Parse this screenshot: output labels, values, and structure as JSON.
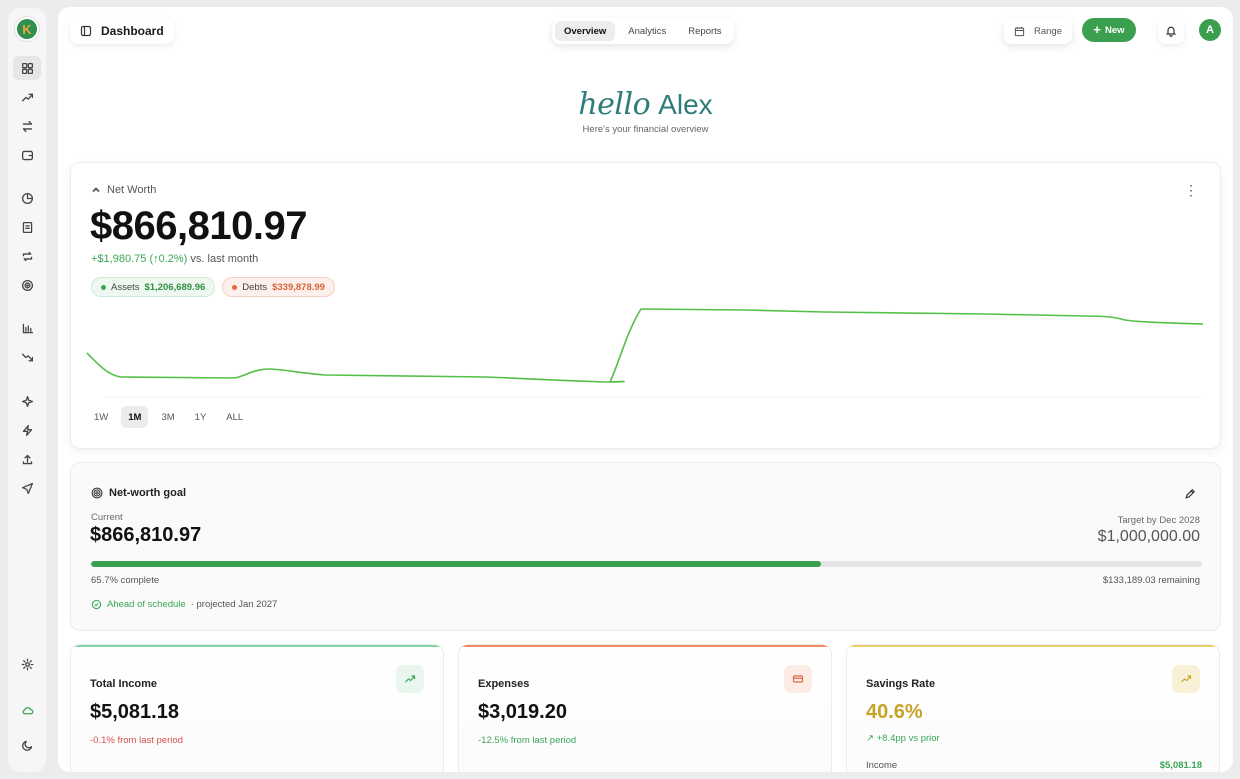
{
  "header": {
    "title": "Dashboard",
    "tabs": [
      "Overview",
      "Analytics",
      "Reports"
    ],
    "range_label": "Range",
    "new_label": "New",
    "avatar_initial": "A"
  },
  "greeting": {
    "hello": "hello",
    "name": "Alex",
    "subtitle": "Here's your financial overview"
  },
  "net_worth": {
    "label": "Net Worth",
    "value": "$866,810.97",
    "change": "+$1,980.75",
    "change_pct": "(↑0.2%)",
    "change_suffix": "vs. last month",
    "assets_label": "Assets",
    "assets_value": "$1,206,689.96",
    "debts_label": "Debts",
    "debts_value": "$339,878.99",
    "periods": [
      "1W",
      "1M",
      "3M",
      "1Y",
      "ALL"
    ],
    "active_period": "1M",
    "line_color": "#55c048"
  },
  "goal": {
    "title": "Net-worth goal",
    "current_label": "Current",
    "current_value": "$866,810.97",
    "target_label": "Target by Dec 2028",
    "target_value": "$1,000,000.00",
    "progress": 0.657,
    "complete_text": "65.7% complete",
    "remaining_text": "$133,189.03 remaining",
    "status": "Ahead of schedule",
    "projection": "· projected Jan 2027"
  },
  "stats": {
    "income": {
      "title": "Total Income",
      "value": "$5,081.18",
      "delta": "-0.1% from last period",
      "accent": "#7fd6a0"
    },
    "expenses": {
      "title": "Expenses",
      "value": "$3,019.20",
      "delta": "-12.5% from last period",
      "accent": "#f08a5f"
    },
    "savings": {
      "title": "Savings Rate",
      "value": "40.6%",
      "delta": "+8.4pp vs prior",
      "accent": "#e8cf6a",
      "income_label": "Income",
      "income_value": "$5,081.18"
    }
  },
  "colors": {
    "brand_green": "#3a9f4f",
    "positive": "#3aa657",
    "negative": "#d9534f",
    "savings_gold": "#c9a227"
  },
  "icons": {
    "sidebar": [
      "dashboard-icon",
      "trending-up-icon",
      "transfer-icon",
      "wallet-icon",
      "pie-chart-icon",
      "receipt-icon",
      "repeat-icon",
      "target-icon",
      "bar-chart-icon",
      "trending-down-icon",
      "sparkles-icon",
      "lightning-icon",
      "upload-icon",
      "plane-icon",
      "settings-icon",
      "cloud-icon",
      "moon-icon"
    ]
  }
}
